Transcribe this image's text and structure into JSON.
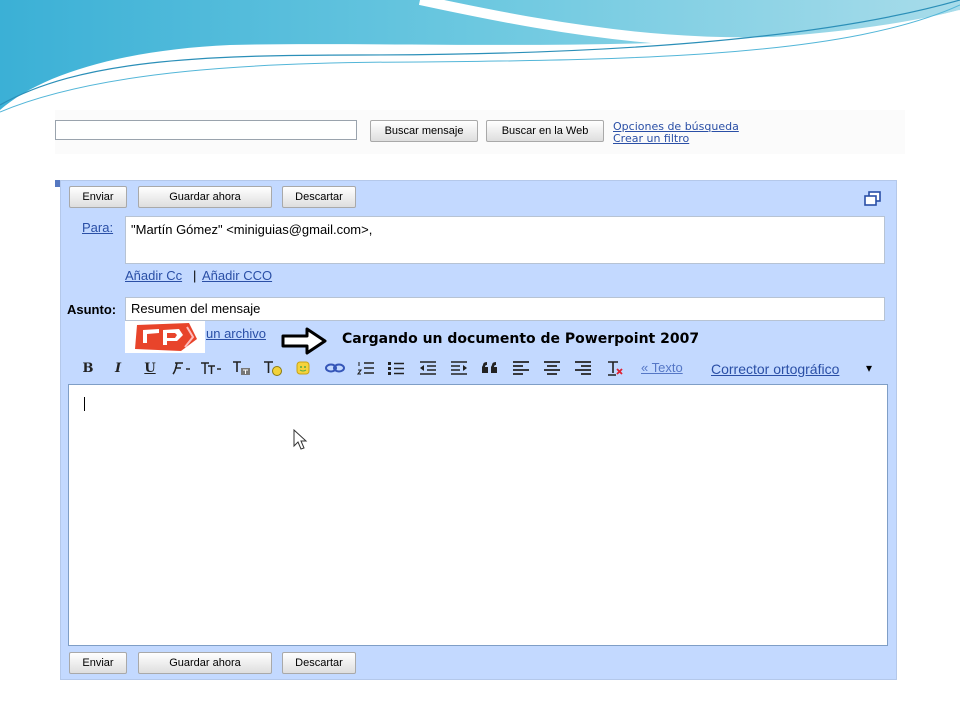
{
  "search": {
    "value": "",
    "buttons": [
      "Buscar mensaje",
      "Buscar en la Web"
    ],
    "links": [
      "Opciones de búsqueda",
      "Crear un filtro"
    ]
  },
  "compose": {
    "top_actions": [
      "Enviar",
      "Guardar ahora",
      "Descartar"
    ],
    "bottom_actions": [
      "Enviar",
      "Guardar ahora",
      "Descartar"
    ],
    "to_label": "Para:",
    "to_value": "\"Martín Gómez\" <miniguias@gmail.com>,",
    "add_cc": "Añadir Cc",
    "separator": "|",
    "add_bcc": "Añadir CCO",
    "subject_label": "Asunto:",
    "subject_value": "Resumen del mensaje",
    "attach_link": "un archivo",
    "annotation": "Cargando un documento de Powerpoint 2007",
    "toolbar": {
      "bold": "B",
      "italic": "I",
      "underline": "U",
      "text_link": "« Texto",
      "spellcheck": "Corrector ortográfico",
      "spellcheck_arrow": "▾"
    },
    "editor_value": ""
  },
  "colors": {
    "compose_bg": "#c3d9ff",
    "link": "#2a4fa6",
    "annotation_arrow": "#000000",
    "logo_red": "#e8442b"
  },
  "icons": [
    "new-window-icon",
    "font-icon",
    "font-size-icon",
    "text-color-icon",
    "highlight-icon",
    "emoticon-icon",
    "link-icon",
    "numbered-list-icon",
    "bulleted-list-icon",
    "indent-less-icon",
    "indent-more-icon",
    "quote-icon",
    "align-left-icon",
    "align-center-icon",
    "align-right-icon",
    "remove-formatting-icon",
    "mouse-cursor-icon",
    "powerpoint-logo-icon"
  ]
}
